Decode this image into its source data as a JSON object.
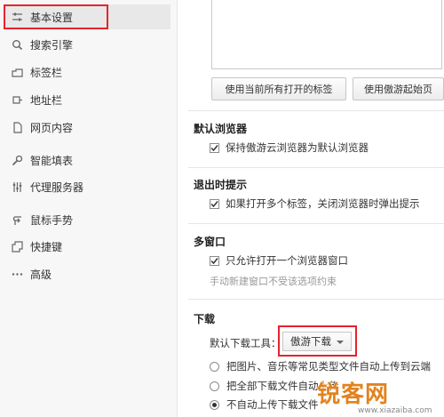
{
  "sidebar": {
    "items": [
      {
        "label": "基本设置",
        "icon": "sliders-icon",
        "active": true
      },
      {
        "label": "搜索引擎",
        "icon": "search-icon"
      },
      {
        "label": "标签栏",
        "icon": "tabs-icon"
      },
      {
        "label": "地址栏",
        "icon": "address-bar-icon"
      },
      {
        "label": "网页内容",
        "icon": "page-icon"
      },
      {
        "label": "智能填表",
        "icon": "wrench-icon"
      },
      {
        "label": "代理服务器",
        "icon": "proxy-icon"
      },
      {
        "label": "鼠标手势",
        "icon": "mouse-gesture-icon"
      },
      {
        "label": "快捷键",
        "icon": "keyboard-icon"
      },
      {
        "label": "高级",
        "icon": "more-icon"
      }
    ]
  },
  "homepage": {
    "use_current_tabs_label": "使用当前所有打开的标签",
    "use_aoyou_start_label": "使用傲游起始页"
  },
  "default_browser": {
    "title": "默认浏览器",
    "option_label": "保持傲游云浏览器为默认浏览器",
    "checked": true
  },
  "exit_prompt": {
    "title": "退出时提示",
    "option_label": "如果打开多个标签，关闭浏览器时弹出提示",
    "checked": true
  },
  "multi_window": {
    "title": "多窗口",
    "option_label": "只允许打开一个浏览器窗口",
    "checked": true,
    "hint": "手动新建窗口不受该选项约束"
  },
  "download": {
    "title": "下载",
    "tool_label": "默认下载工具：",
    "tool_value": "傲游下载",
    "options": [
      {
        "label": "把图片、音乐等常见类型文件自动上传到云端",
        "selected": false
      },
      {
        "label": "把全部下载文件自动上传",
        "selected": false
      },
      {
        "label": "不自动上传下载文件",
        "selected": true
      }
    ]
  },
  "watermark": {
    "text": "锐客网",
    "url": "www.xiazaiba.com"
  },
  "colors": {
    "highlight": "#e5232d",
    "sidebar_bg": "#f7f7f7",
    "active_bg": "#e8e8e8",
    "watermark": "#e2831e"
  }
}
